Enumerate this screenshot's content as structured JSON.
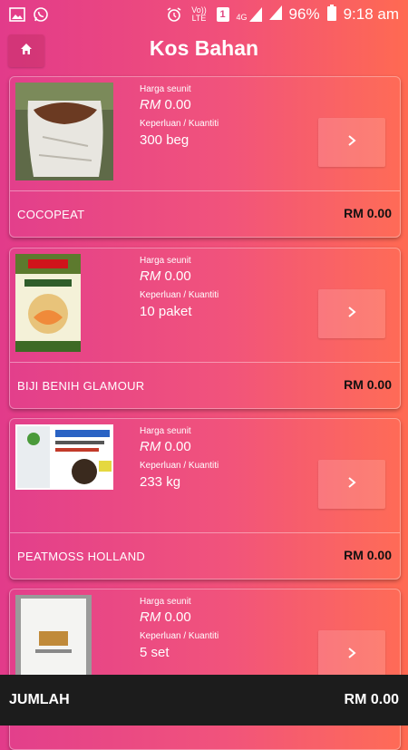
{
  "status_bar": {
    "icons": [
      "image-icon",
      "whatsapp-icon",
      "alarm-icon",
      "volte-icon",
      "sim-1-icon",
      "4g-signal-icon",
      "signal-icon"
    ],
    "volte_label": "Vo)) LTE",
    "sim_label": "1",
    "network_label": "4G",
    "battery": "96%",
    "time": "9:18 am"
  },
  "appbar": {
    "title": "Kos Bahan",
    "home_icon": "home-icon"
  },
  "labels": {
    "unit_price": "Harga seunit",
    "quantity": "Keperluan / Kuantiti",
    "currency": "RM"
  },
  "items": [
    {
      "name": "COCOPEAT",
      "unit_price": "0.00",
      "quantity": "300 beg",
      "total": "RM 0.00"
    },
    {
      "name": "BIJI BENIH GLAMOUR",
      "unit_price": "0.00",
      "quantity": "10 paket",
      "total": "RM 0.00"
    },
    {
      "name": "PEATMOSS HOLLAND",
      "unit_price": "0.00",
      "quantity": "233 kg",
      "total": "RM 0.00"
    },
    {
      "name": "",
      "unit_price": "0.00",
      "quantity": "5 set",
      "total": ""
    }
  ],
  "footer": {
    "label": "JUMLAH",
    "total": "RM 0.00"
  },
  "colors": {
    "gradient_start": "#e23b8a",
    "gradient_end": "#ff6a52",
    "footer_bg": "#1c1c1c"
  }
}
